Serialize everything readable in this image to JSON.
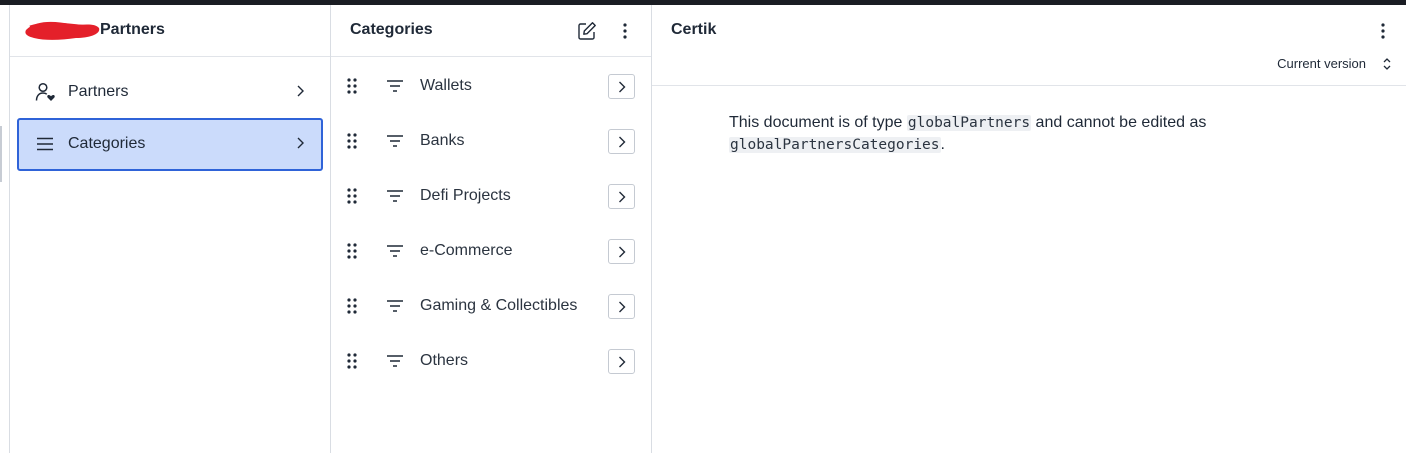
{
  "workspace": {
    "title": "Partners"
  },
  "nav": {
    "items": [
      {
        "label": "Partners",
        "icon": "person-heart-icon",
        "selected": false
      },
      {
        "label": "Categories",
        "icon": "menu-lines-icon",
        "selected": true
      }
    ]
  },
  "categories_pane": {
    "title": "Categories",
    "items": [
      {
        "label": "Wallets"
      },
      {
        "label": "Banks"
      },
      {
        "label": "Defi Projects"
      },
      {
        "label": "e-Commerce"
      },
      {
        "label": "Gaming & Collectibles"
      },
      {
        "label": "Others"
      }
    ]
  },
  "document_pane": {
    "title": "Certik",
    "version_label": "Current version",
    "message": {
      "prefix": "This document is of type",
      "type_code": "globalPartners",
      "middle": "and cannot be edited as",
      "target_code": "globalPartnersCategories",
      "suffix": "."
    }
  },
  "colors": {
    "selected_bg": "#cbdbfb",
    "selected_border": "#2f63d8",
    "redaction": "#e4202a",
    "topbar": "#1a1d23"
  }
}
